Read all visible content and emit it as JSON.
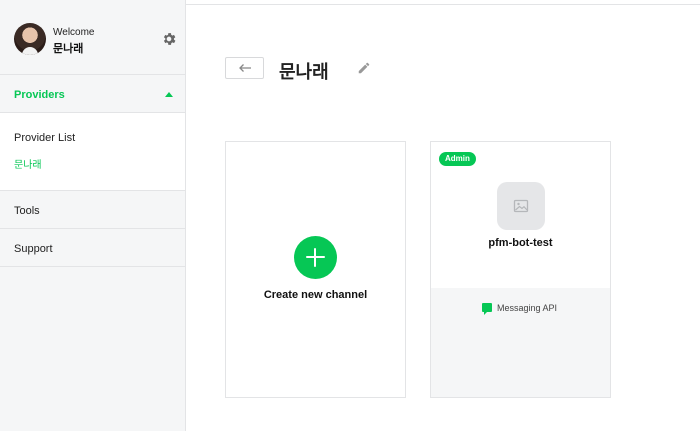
{
  "sidebar": {
    "welcome_label": "Welcome",
    "user_name": "문나래",
    "providers_label": "Providers",
    "provider_list_label": "Provider List",
    "current_provider": "문나래",
    "items": [
      {
        "label": "Tools"
      },
      {
        "label": "Support"
      }
    ]
  },
  "main": {
    "title": "문나래",
    "create_label": "Create new channel",
    "channel": {
      "badge": "Admin",
      "name": "pfm-bot-test",
      "type_label": "Messaging API"
    }
  },
  "colors": {
    "accent": "#06c755",
    "sidebar_bg": "#f5f6f7",
    "border": "#e3e4e6"
  },
  "icons": [
    "gear-icon",
    "chevron-up-icon",
    "back-arrow-icon",
    "pencil-icon",
    "plus-icon",
    "image-placeholder-icon",
    "chat-icon"
  ]
}
